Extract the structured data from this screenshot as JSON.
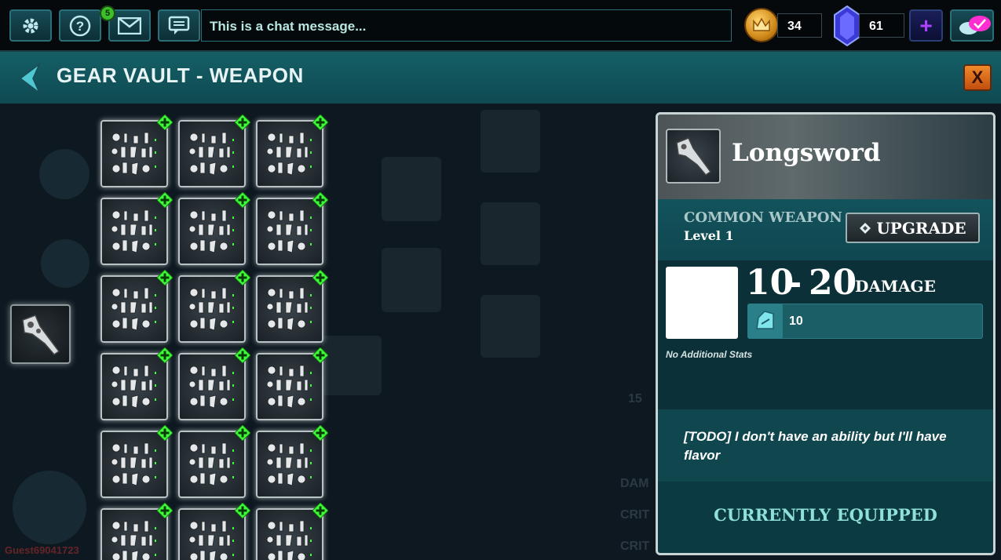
{
  "topbar": {
    "notification_count": "5",
    "chat_placeholder": "This is a chat message...",
    "gold_amount": "34",
    "gem_amount": "61",
    "plus_label": "+"
  },
  "header": {
    "title": "GEAR VAULT - WEAPON",
    "close_label": "X"
  },
  "inventory": {
    "columns": 3,
    "rows": 6
  },
  "detail": {
    "name": "Longsword",
    "rarity": "COMMON WEAPON",
    "level": "Level 1",
    "upgrade_label": "UPGRADE",
    "damage_min": "10",
    "damage_sep": "-",
    "damage_max": "20",
    "damage_label": "DAMAGE",
    "stat_value": "10",
    "no_stats": "No Additional Stats",
    "flavor_tag": "[TODO]",
    "flavor_text": " I don't have an ability but I'll have flavor",
    "equipped_label": "CURRENTLY EQUIPPED"
  },
  "background": {
    "guest_name": "Guest69041723",
    "faded_stat_labels": [
      "DAM",
      "CRIT",
      "CRIT"
    ],
    "faded_number": "15"
  },
  "colors": {
    "accent_teal": "#155f66",
    "plus_green": "#3cff3a",
    "close_orange": "#e0701e"
  }
}
